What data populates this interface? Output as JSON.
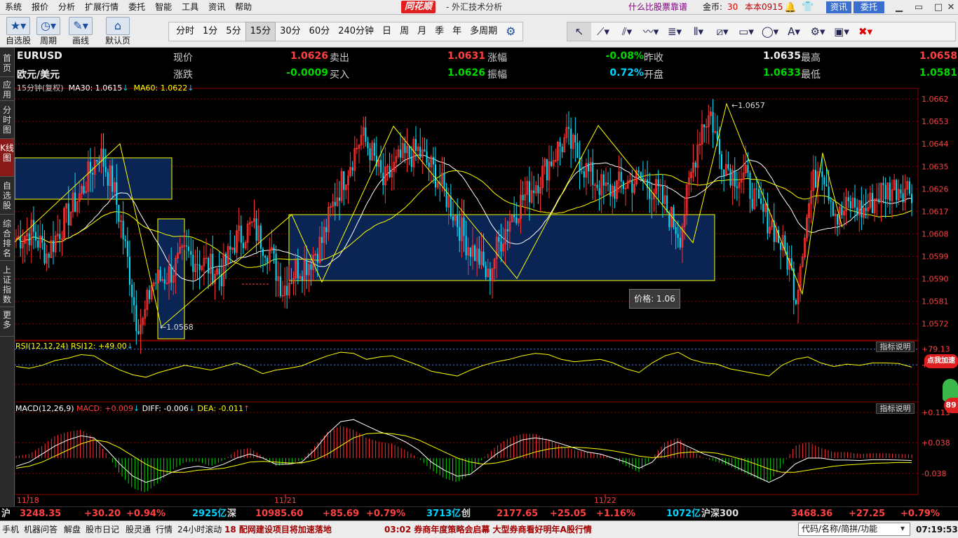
{
  "menubar": {
    "items": [
      "系统",
      "报价",
      "分析",
      "扩展行情",
      "委托",
      "智能",
      "工具",
      "资讯",
      "帮助"
    ],
    "brand": "同花顺",
    "title": "- 外汇技术分析",
    "promo": "什么比股票靠谱",
    "gold_label": "金币:",
    "gold_value": "30",
    "account": "本本0915",
    "info_button": "资讯",
    "trade_button": "委托"
  },
  "toolbar": {
    "buttons": [
      "自选股",
      "周期",
      "画线",
      "默认页"
    ],
    "periods": [
      "分时",
      "1分",
      "5分",
      "15分",
      "30分",
      "60分",
      "240分钟",
      "日",
      "周",
      "月",
      "季",
      "年",
      "多周期"
    ],
    "active_period": "15分"
  },
  "left_tabs": [
    "首页",
    "应用",
    "分时图",
    "K线图",
    "自选股",
    "综合排名",
    "上证指数",
    "更多"
  ],
  "quote": {
    "symbol": "EURUSD",
    "name": "欧元/美元",
    "fields": [
      {
        "label": "现价",
        "value": "1.0626"
      },
      {
        "label": "卖出",
        "value": "1.0631"
      },
      {
        "label": "涨幅",
        "value": "-0.08%"
      },
      {
        "label": "昨收",
        "value": "1.0635"
      },
      {
        "label": "最高",
        "value": "1.0658"
      },
      {
        "label": "涨跌",
        "value": "-0.0009"
      },
      {
        "label": "买入",
        "value": "1.0626"
      },
      {
        "label": "振幅",
        "value": "0.72%"
      },
      {
        "label": "开盘",
        "value": "1.0633"
      },
      {
        "label": "最低",
        "value": "1.0581"
      }
    ]
  },
  "ma_line": {
    "period": "15分钟(复权)",
    "ma30": "MA30: 1.0615",
    "ma60": "MA60: 1.0622"
  },
  "rsi_line": {
    "label": "RSI(12,12,24)",
    "value": "RSI12: +49.00"
  },
  "macd_line": {
    "label": "MACD(12,26,9)",
    "macd": "MACD: +0.009",
    "diff": "DIFF: -0.006",
    "dea": "DEA: -0.011"
  },
  "indicator_help": "指标说明",
  "price_tip": "价格: 1.06",
  "speed_badge": "点我加速",
  "num_badge": "89",
  "high_marker": "1.0657",
  "low_marker": "1.0568",
  "colors": {
    "up": "#ff3232",
    "down": "#00e4ff",
    "ma30": "#ffffff",
    "ma60": "#ffff00",
    "grid": "#8a0000",
    "box": "#0a2454",
    "box_border": "#ffff00"
  },
  "chart_data": [
    {
      "type": "candlestick",
      "title": "EURUSD",
      "y_ticks": [
        "1.0662",
        "1.0653",
        "1.0644",
        "1.0635",
        "1.0626",
        "1.0617",
        "1.0608",
        "1.0599",
        "1.0590",
        "1.0581",
        "1.0572"
      ],
      "x_ticks": [
        "11/18",
        "11/21",
        "11/22"
      ],
      "ylim": [
        1.0566,
        1.0664
      ],
      "anchors": [
        [
          0,
          1.0606
        ],
        [
          7,
          1.0609
        ],
        [
          14,
          1.06
        ],
        [
          22,
          1.0613
        ],
        [
          30,
          1.0625
        ],
        [
          38,
          1.0641
        ],
        [
          44,
          1.0628
        ],
        [
          48,
          1.0612
        ],
        [
          52,
          1.0592
        ],
        [
          55,
          1.0574
        ],
        [
          58,
          1.0572
        ],
        [
          62,
          1.0588
        ],
        [
          70,
          1.0592
        ],
        [
          78,
          1.06
        ],
        [
          86,
          1.0596
        ],
        [
          94,
          1.0592
        ],
        [
          100,
          1.0605
        ],
        [
          108,
          1.0611
        ],
        [
          116,
          1.0601
        ],
        [
          122,
          1.0586
        ],
        [
          128,
          1.0594
        ],
        [
          134,
          1.0597
        ],
        [
          140,
          1.0605
        ],
        [
          146,
          1.0622
        ],
        [
          152,
          1.0635
        ],
        [
          158,
          1.0647
        ],
        [
          162,
          1.0642
        ],
        [
          168,
          1.0628
        ],
        [
          176,
          1.0638
        ],
        [
          184,
          1.0641
        ],
        [
          192,
          1.0632
        ],
        [
          198,
          1.0621
        ],
        [
          206,
          1.0605
        ],
        [
          212,
          1.0598
        ],
        [
          216,
          1.059
        ],
        [
          220,
          1.0602
        ],
        [
          226,
          1.0614
        ],
        [
          232,
          1.0622
        ],
        [
          240,
          1.0631
        ],
        [
          248,
          1.0642
        ],
        [
          252,
          1.0646
        ],
        [
          256,
          1.0641
        ],
        [
          262,
          1.0632
        ],
        [
          270,
          1.0625
        ],
        [
          278,
          1.0628
        ],
        [
          286,
          1.063
        ],
        [
          294,
          1.0624
        ],
        [
          300,
          1.0614
        ],
        [
          304,
          1.0608
        ],
        [
          310,
          1.0636
        ],
        [
          314,
          1.0652
        ],
        [
          318,
          1.0656
        ],
        [
          322,
          1.064
        ],
        [
          328,
          1.0632
        ],
        [
          334,
          1.063
        ],
        [
          340,
          1.0618
        ],
        [
          346,
          1.0612
        ],
        [
          350,
          1.0604
        ],
        [
          354,
          1.0596
        ],
        [
          357,
          1.0583
        ],
        [
          360,
          1.0604
        ],
        [
          364,
          1.0625
        ],
        [
          368,
          1.0638
        ],
        [
          372,
          1.0626
        ],
        [
          376,
          1.0614
        ],
        [
          382,
          1.062
        ],
        [
          388,
          1.0617
        ],
        [
          396,
          1.0625
        ],
        [
          404,
          1.0627
        ],
        [
          410,
          1.0626
        ]
      ],
      "n_candles": 411
    },
    {
      "type": "line",
      "title": "RSI(12,12,24)",
      "y_ticks": [
        "+79.13",
        "+52.73"
      ],
      "series": [
        {
          "name": "RSI12",
          "values": [
            50,
            47,
            52,
            60,
            64,
            70,
            68,
            55,
            44,
            36,
            32,
            40,
            46,
            52,
            48,
            44,
            50,
            56,
            48,
            38,
            44,
            47,
            51,
            60,
            68,
            74,
            72,
            62,
            66,
            68,
            60,
            52,
            42,
            38,
            34,
            44,
            52,
            58,
            62,
            68,
            72,
            70,
            62,
            58,
            60,
            62,
            56,
            46,
            40,
            56,
            68,
            74,
            62,
            56,
            54,
            46,
            42,
            38,
            34,
            52,
            62,
            66,
            56,
            50,
            54,
            52,
            56,
            56,
            55,
            49
          ]
        }
      ]
    },
    {
      "type": "bar",
      "title": "MACD(12,26,9)",
      "y_ticks": [
        "+0.113",
        "+0.038",
        "-0.038"
      ],
      "series": [
        {
          "name": "MACD",
          "values": [
            0.005,
            0.01,
            0.03,
            0.055,
            0.065,
            0.07,
            0.05,
            0.01,
            -0.04,
            -0.075,
            -0.085,
            -0.06,
            -0.03,
            -0.01,
            -0.008,
            -0.02,
            -0.005,
            0.02,
            0.025,
            0.005,
            -0.02,
            -0.015,
            -0.005,
            0.03,
            0.065,
            0.08,
            0.07,
            0.05,
            0.04,
            0.035,
            0.02,
            0.0,
            -0.03,
            -0.05,
            -0.06,
            -0.04,
            0.0,
            0.03,
            0.05,
            0.06,
            0.06,
            0.045,
            0.03,
            0.02,
            0.015,
            0.01,
            0.0,
            -0.02,
            -0.035,
            0.0,
            0.04,
            0.05,
            0.02,
            0.0,
            -0.01,
            -0.02,
            -0.035,
            -0.05,
            -0.06,
            -0.02,
            0.03,
            0.04,
            0.025,
            0.015,
            0.015,
            0.01,
            0.012,
            0.012,
            0.01,
            0.009
          ]
        },
        {
          "name": "DIFF",
          "values": [
            -0.02,
            -0.01,
            0.01,
            0.03,
            0.045,
            0.055,
            0.05,
            0.02,
            -0.015,
            -0.045,
            -0.06,
            -0.05,
            -0.035,
            -0.025,
            -0.02,
            -0.025,
            -0.015,
            0.0,
            0.01,
            0.0,
            -0.015,
            -0.015,
            -0.01,
            0.02,
            0.06,
            0.09,
            0.095,
            0.08,
            0.065,
            0.055,
            0.04,
            0.02,
            -0.01,
            -0.03,
            -0.045,
            -0.04,
            -0.015,
            0.01,
            0.03,
            0.045,
            0.05,
            0.045,
            0.035,
            0.025,
            0.015,
            0.01,
            0.0,
            -0.01,
            -0.025,
            -0.01,
            0.025,
            0.04,
            0.025,
            0.01,
            0.0,
            -0.015,
            -0.03,
            -0.045,
            -0.06,
            -0.045,
            -0.015,
            0.0,
            0.0,
            -0.005,
            -0.005,
            -0.006,
            -0.004,
            -0.004,
            -0.005,
            -0.006
          ]
        },
        {
          "name": "DEA",
          "values": [
            -0.025,
            -0.02,
            -0.01,
            0.005,
            0.02,
            0.035,
            0.045,
            0.04,
            0.025,
            0.005,
            -0.015,
            -0.03,
            -0.035,
            -0.035,
            -0.03,
            -0.028,
            -0.025,
            -0.018,
            -0.01,
            -0.008,
            -0.01,
            -0.012,
            -0.012,
            -0.005,
            0.01,
            0.03,
            0.05,
            0.06,
            0.062,
            0.06,
            0.055,
            0.045,
            0.03,
            0.015,
            0.0,
            -0.01,
            -0.015,
            -0.012,
            -0.005,
            0.005,
            0.015,
            0.022,
            0.026,
            0.027,
            0.025,
            0.022,
            0.018,
            0.012,
            0.005,
            0.001,
            0.004,
            0.012,
            0.015,
            0.015,
            0.012,
            0.005,
            -0.004,
            -0.015,
            -0.027,
            -0.035,
            -0.035,
            -0.03,
            -0.025,
            -0.02,
            -0.017,
            -0.015,
            -0.013,
            -0.012,
            -0.011,
            -0.011
          ]
        }
      ]
    }
  ],
  "status": {
    "sh_label": "沪",
    "sh_index": "3248.35",
    "sh_change": "+30.20",
    "sh_pct": "+0.94%",
    "sh_amount": "2925亿",
    "sz_label": "深",
    "sz_index": "10985.60",
    "sz_change": "+85.69",
    "sz_pct": "+0.79%",
    "sz_amount": "3713亿",
    "cy_label": "创",
    "cy_index": "2177.65",
    "cy_change": "+25.05",
    "cy_pct": "+1.16%",
    "cy_amount": "1072亿",
    "hs_label": "沪深300",
    "hs_index": "3468.36",
    "hs_change": "+27.25",
    "hs_pct": "+0.79%"
  },
  "bottom": {
    "items": [
      "手机",
      "机器问答",
      "解盘",
      "股市日记",
      "股灵通",
      "行情",
      "24小时滚动"
    ],
    "news1": "18 配网建设项目将加速落地",
    "news2": "03:02 券商年度策略会启幕  大型券商看好明年A股行情",
    "search_placeholder": "代码/名称/简拼/功能",
    "clock": "07:19:53"
  }
}
